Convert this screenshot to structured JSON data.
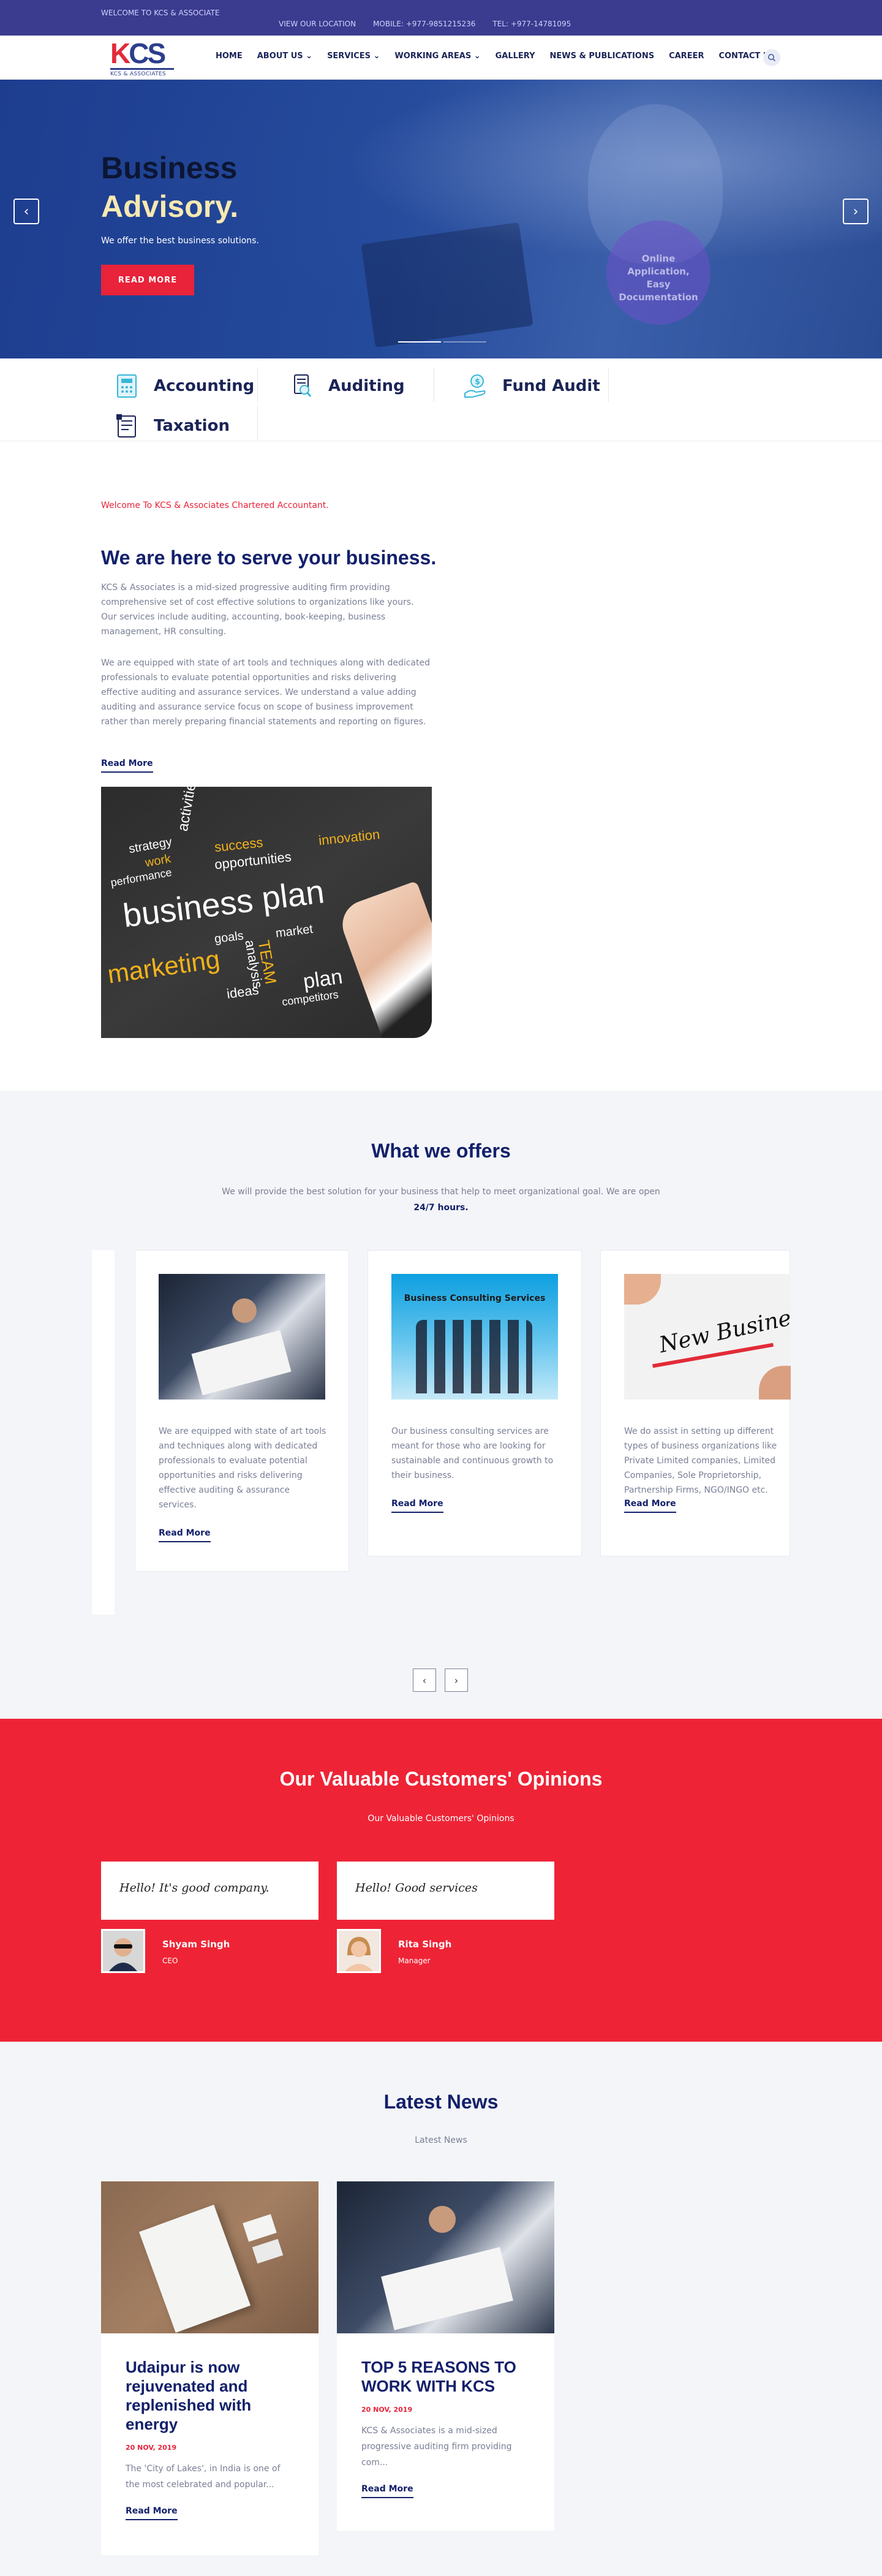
{
  "topbar": {
    "welcome": "WELCOME TO KCS & ASSOCIATE",
    "location": "VIEW OUR LOCATION",
    "mobile": "MOBILE: +977-9851215236",
    "tel": "TEL: +977-14781095"
  },
  "logo": {
    "mark": "KCS",
    "sub": "KCS & ASSOCIATES"
  },
  "nav": [
    {
      "label": "HOME"
    },
    {
      "label": "ABOUT US ⌄"
    },
    {
      "label": "SERVICES ⌄"
    },
    {
      "label": "WORKING AREAS ⌄"
    },
    {
      "label": "GALLERY"
    },
    {
      "label": "NEWS & PUBLICATIONS"
    },
    {
      "label": "CAREER"
    },
    {
      "label": "CONTACT US"
    }
  ],
  "hero": {
    "title_line1": "Business",
    "title_line2": "Advisory.",
    "tagline": "We offer the best business solutions.",
    "button": "READ MORE",
    "prev": "‹",
    "next": "›",
    "badge_lines": [
      "Online",
      "Application,",
      "Easy",
      "Documentation"
    ]
  },
  "services": [
    "Accounting",
    "Auditing",
    "Fund Audit",
    "Taxation"
  ],
  "about": {
    "welcome": "Welcome To KCS & Associates Chartered Accountant.",
    "heading": "We are here to serve your business.",
    "para1": "KCS & Associates is a mid-sized progressive auditing firm providing comprehensive set of cost effective solutions to organizations like yours. Our services include auditing, accounting, book-keeping, business management, HR consulting.",
    "para2": "We are equipped with state of art tools and techniques along with dedicated professionals to evaluate potential opportunities and risks delivering effective auditing and assurance services. We understand a value adding auditing and assurance service focus on scope of business improvement rather than merely preparing financial statements and reporting on figures.",
    "read_more": "Read More",
    "board_words": [
      "strategy",
      "work",
      "performance",
      "activities",
      "success",
      "innovation",
      "opportunities",
      "business plan",
      "goals",
      "market",
      "marketing",
      "TEAM",
      "analysis",
      "ideas",
      "plan",
      "competitors"
    ]
  },
  "offers": {
    "heading": "What we offers",
    "lead": "We will provide the best solution for your business that help to meet organizational goal. We are open",
    "lead_bold": "24/7 hours.",
    "cards": [
      {
        "text": "We are equipped with state of art tools and techniques along with dedicated professionals to evaluate potential opportunities and risks delivering effective auditing & assurance services.",
        "read_more": "Read More"
      },
      {
        "text": "Our business consulting services are meant for those who are looking for sustainable and continuous growth to their business.",
        "read_more": "Read More",
        "image_caption": "Business Consulting Services"
      },
      {
        "text": "We do assist in setting up different types of business organizations like Private Limited companies, Limited Companies, Sole Proprietorship, Partnership Firms, NGO/INGO etc.",
        "read_more": "Read More",
        "image_caption": "New Business"
      }
    ],
    "prev": "‹",
    "next": "›"
  },
  "testimonials": {
    "heading": "Our Valuable Customers' Opinions",
    "sub": "Our Valuable Customers'  Opinions",
    "items": [
      {
        "quote": "Hello! It's good company.",
        "name": "Shyam Singh",
        "role": "CEO"
      },
      {
        "quote": "Hello! Good services",
        "name": "Rita Singh",
        "role": "Manager"
      }
    ]
  },
  "news": {
    "heading": "Latest News",
    "sub": "Latest News",
    "items": [
      {
        "title": "Udaipur is now rejuvenated and replenished with energy",
        "date": "20 NOV, 2019",
        "excerpt": "The 'City of Lakes', in India is one of the most celebrated and popular...",
        "read_more": "Read More"
      },
      {
        "title": "TOP 5 REASONS TO WORK WITH KCS",
        "date": "20 NOV, 2019",
        "excerpt": "KCS & Associates is a mid-sized progressive auditing firm providing com...",
        "read_more": "Read More"
      }
    ]
  },
  "colors": {
    "brand_blue": "#13206b",
    "accent_red": "#e8233a",
    "topbar": "#3b3b8f"
  }
}
